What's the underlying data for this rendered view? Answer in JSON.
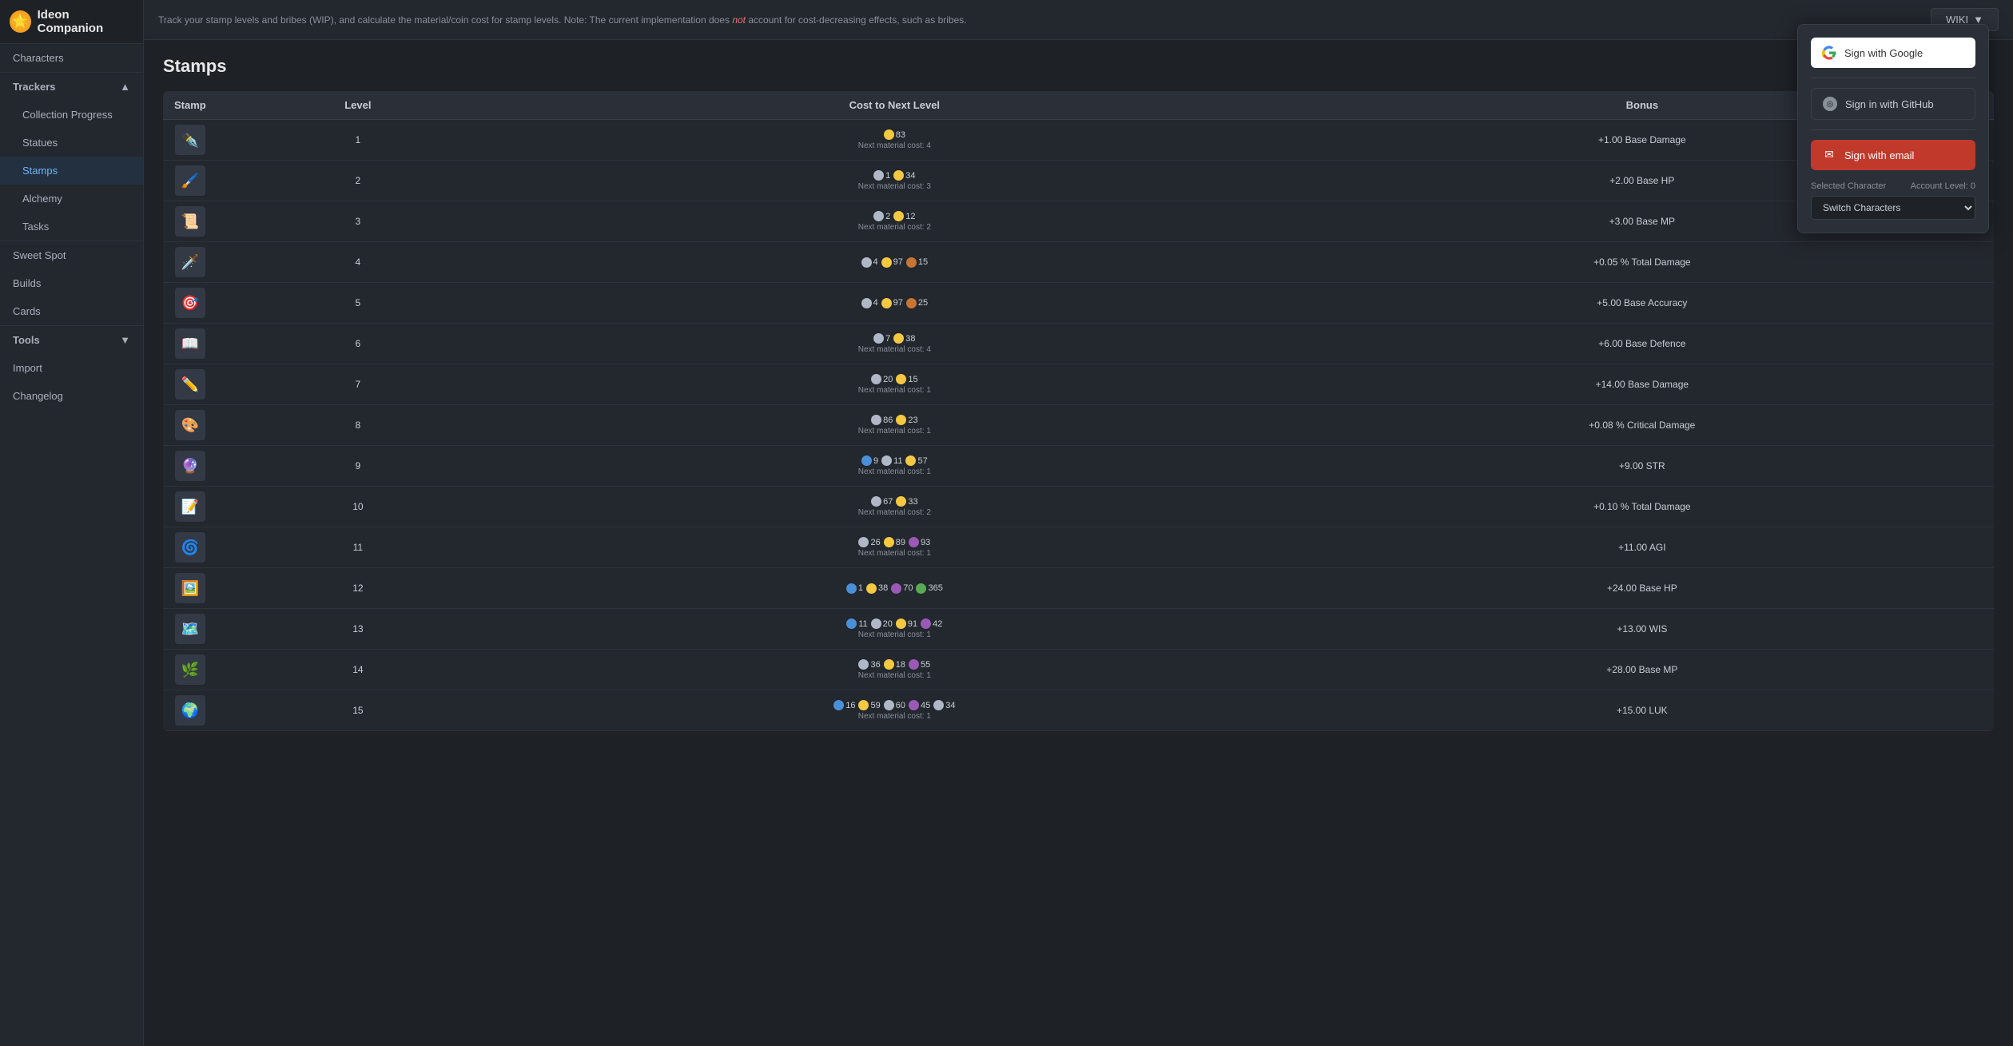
{
  "app": {
    "title": "Ideon Companion",
    "logo": "🌟"
  },
  "sidebar": {
    "items": [
      {
        "id": "characters",
        "label": "Characters",
        "active": false
      },
      {
        "id": "trackers",
        "label": "Trackers",
        "section": true,
        "expanded": true
      },
      {
        "id": "collection-progress",
        "label": "Collection Progress",
        "active": false,
        "sub": true
      },
      {
        "id": "statues",
        "label": "Statues",
        "active": false,
        "sub": true
      },
      {
        "id": "stamps",
        "label": "Stamps",
        "active": true,
        "sub": true
      },
      {
        "id": "alchemy",
        "label": "Alchemy",
        "active": false,
        "sub": true
      },
      {
        "id": "tasks",
        "label": "Tasks",
        "active": false,
        "sub": true
      },
      {
        "id": "sweet-spot",
        "label": "Sweet Spot",
        "active": false
      },
      {
        "id": "builds",
        "label": "Builds",
        "active": false
      },
      {
        "id": "cards",
        "label": "Cards",
        "active": false
      },
      {
        "id": "tools",
        "label": "Tools",
        "section": true,
        "expanded": false
      },
      {
        "id": "import",
        "label": "Import",
        "active": false
      },
      {
        "id": "changelog",
        "label": "Changelog",
        "active": false
      }
    ]
  },
  "topbar": {
    "info": "Track your stamp levels and bribes (WIP), and calculate the material/coin cost for stamp levels. Note: The current implementation does not account for cost-decreasing effects, such as bribes.",
    "wiki_label": "WIKI",
    "wiki_arrow": "▼"
  },
  "stamps_section": {
    "title": "Stamps",
    "table": {
      "columns": [
        "Stamp",
        "Level",
        "Cost to Next Level",
        "Bonus"
      ],
      "rows": [
        {
          "level": 1,
          "icon": "✒️",
          "costs": [
            {
              "type": "gold",
              "amount": "83"
            }
          ],
          "next_mat": "Next material cost: 4",
          "bonus": "+1.00 Base Damage"
        },
        {
          "level": 2,
          "icon": "🖌️",
          "costs": [
            {
              "type": "silver",
              "amount": "1"
            },
            {
              "type": "gold",
              "amount": "34"
            }
          ],
          "next_mat": "Next material cost: 3",
          "bonus": "+2.00 Base HP"
        },
        {
          "level": 3,
          "icon": "📜",
          "costs": [
            {
              "type": "silver",
              "amount": "2"
            },
            {
              "type": "gold",
              "amount": "12"
            }
          ],
          "next_mat": "Next material cost: 2",
          "bonus": "+3.00 Base MP"
        },
        {
          "level": 4,
          "icon": "🗡️",
          "costs": [
            {
              "type": "silver",
              "amount": "4"
            },
            {
              "type": "gold",
              "amount": "97"
            },
            {
              "type": "copper",
              "amount": "15"
            }
          ],
          "next_mat": "",
          "bonus": "+0.05 % Total Damage"
        },
        {
          "level": 5,
          "icon": "🎯",
          "costs": [
            {
              "type": "silver",
              "amount": "4"
            },
            {
              "type": "gold",
              "amount": "97"
            },
            {
              "type": "copper",
              "amount": "25"
            }
          ],
          "next_mat": "",
          "bonus": "+5.00 Base Accuracy"
        },
        {
          "level": 6,
          "icon": "📖",
          "costs": [
            {
              "type": "silver",
              "amount": "7"
            },
            {
              "type": "gold",
              "amount": "38"
            }
          ],
          "next_mat": "Next material cost: 4",
          "bonus": "+6.00 Base Defence"
        },
        {
          "level": 7,
          "icon": "✏️",
          "costs": [
            {
              "type": "silver",
              "amount": "20"
            },
            {
              "type": "gold",
              "amount": "15"
            }
          ],
          "next_mat": "Next material cost: 1",
          "bonus": "+14.00 Base Damage"
        },
        {
          "level": 8,
          "icon": "🎨",
          "costs": [
            {
              "type": "silver",
              "amount": "86"
            },
            {
              "type": "gold",
              "amount": "23"
            }
          ],
          "next_mat": "Next material cost: 1",
          "bonus": "+0.08 % Critical Damage"
        },
        {
          "level": 9,
          "icon": "🔮",
          "costs": [
            {
              "type": "blue",
              "amount": "9"
            },
            {
              "type": "silver",
              "amount": "11"
            },
            {
              "type": "gold",
              "amount": "57"
            }
          ],
          "next_mat": "Next material cost: 1",
          "bonus": "+9.00 STR"
        },
        {
          "level": 10,
          "icon": "📝",
          "costs": [
            {
              "type": "silver",
              "amount": "67"
            },
            {
              "type": "gold",
              "amount": "33"
            }
          ],
          "next_mat": "Next material cost: 2",
          "bonus": "+0.10 % Total Damage"
        },
        {
          "level": 11,
          "icon": "🌀",
          "costs": [
            {
              "type": "silver",
              "amount": "26"
            },
            {
              "type": "gold",
              "amount": "89"
            },
            {
              "type": "purple",
              "amount": "93"
            }
          ],
          "next_mat": "Next material cost: 1",
          "bonus": "+11.00 AGI"
        },
        {
          "level": 12,
          "icon": "🖼️",
          "costs": [
            {
              "type": "blue",
              "amount": "1"
            },
            {
              "type": "gold",
              "amount": "38"
            },
            {
              "type": "purple",
              "amount": "70"
            },
            {
              "type": "green",
              "amount": "365"
            }
          ],
          "next_mat": "",
          "bonus": "+24.00 Base HP"
        },
        {
          "level": 13,
          "icon": "🗺️",
          "costs": [
            {
              "type": "blue",
              "amount": "11"
            },
            {
              "type": "silver",
              "amount": "20"
            },
            {
              "type": "gold",
              "amount": "91"
            },
            {
              "type": "purple",
              "amount": "42"
            }
          ],
          "next_mat": "Next material cost: 1",
          "bonus": "+13.00 WIS"
        },
        {
          "level": 14,
          "icon": "🌿",
          "costs": [
            {
              "type": "silver",
              "amount": "36"
            },
            {
              "type": "gold",
              "amount": "18"
            },
            {
              "type": "purple",
              "amount": "55"
            }
          ],
          "next_mat": "Next material cost: 1",
          "bonus": "+28.00 Base MP"
        },
        {
          "level": 15,
          "icon": "🌍",
          "costs": [
            {
              "type": "blue",
              "amount": "16"
            },
            {
              "type": "gold",
              "amount": "59"
            },
            {
              "type": "silver",
              "amount": "60"
            },
            {
              "type": "purple",
              "amount": "45"
            },
            {
              "type": "silver2",
              "amount": "34"
            }
          ],
          "next_mat": "Next material cost: 1",
          "bonus": "+15.00 LUK"
        }
      ]
    }
  },
  "signin": {
    "google_label": "Sign with Google",
    "github_label": "Sign in with GitHub",
    "email_label": "Sign with email",
    "selected_char_label": "Selected Character",
    "account_level_label": "Account Level: 0",
    "switch_chars_label": "Switch Characters",
    "switch_chars_options": [
      "Switch Characters"
    ]
  }
}
